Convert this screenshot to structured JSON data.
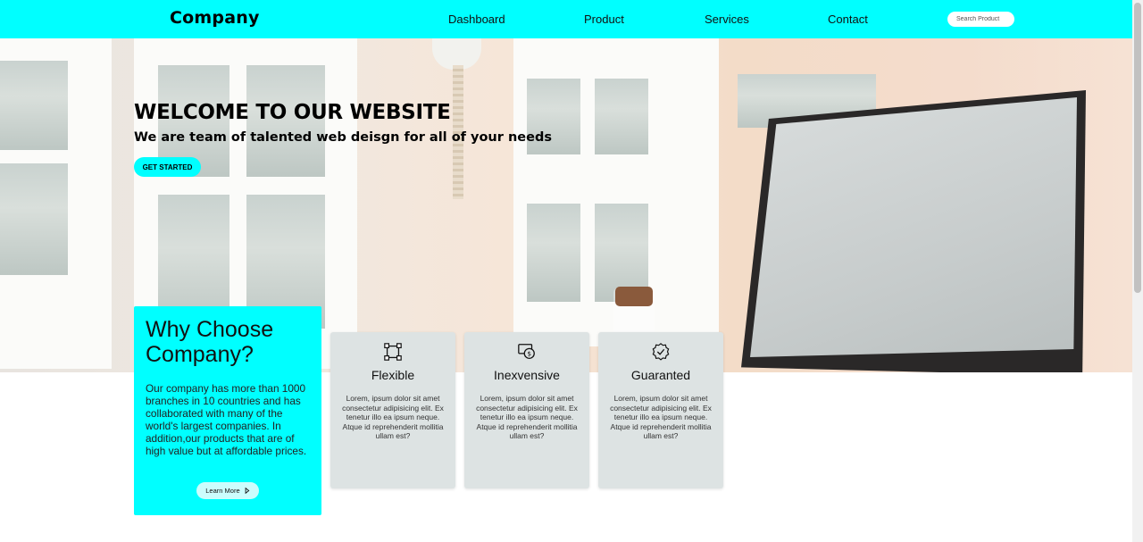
{
  "nav": {
    "logo": "Company",
    "links": [
      "Dashboard",
      "Product",
      "Services",
      "Contact"
    ],
    "search_placeholder": "Search Product"
  },
  "hero": {
    "title": "WELCOME TO OUR WEBSITE",
    "subtitle": "We are team of talented web deisgn for all of your needs",
    "cta_label": "GET STARTED"
  },
  "why": {
    "title": "Why Choose Company?",
    "body": "Our company has more than 1000 branches in 10 countries and has collaborated with many of the world's largest companies. In addition,our products that are of high value but at affordable prices.",
    "button_label": "Learn More",
    "button_icon": "caret-right-icon"
  },
  "features": [
    {
      "title": "Flexible",
      "icon": "frame-icon",
      "body": "Lorem, ipsum dolor sit amet consectetur adipisicing elit. Ex tenetur illo ea ipsum neque. Atque id reprehenderit mollitia ullam est?"
    },
    {
      "title": "Inexvensive",
      "icon": "money-icon",
      "body": "Lorem, ipsum dolor sit amet consectetur adipisicing elit. Ex tenetur illo ea ipsum neque. Atque id reprehenderit mollitia ullam est?"
    },
    {
      "title": "Guaranted",
      "icon": "check-badge-icon",
      "body": "Lorem, ipsum dolor sit amet consectetur adipisicing elit. Ex tenetur illo ea ipsum neque. Atque id reprehenderit mollitia ullam est?"
    }
  ],
  "colors": {
    "accent": "#00ffff",
    "card": "#dde3e3"
  }
}
